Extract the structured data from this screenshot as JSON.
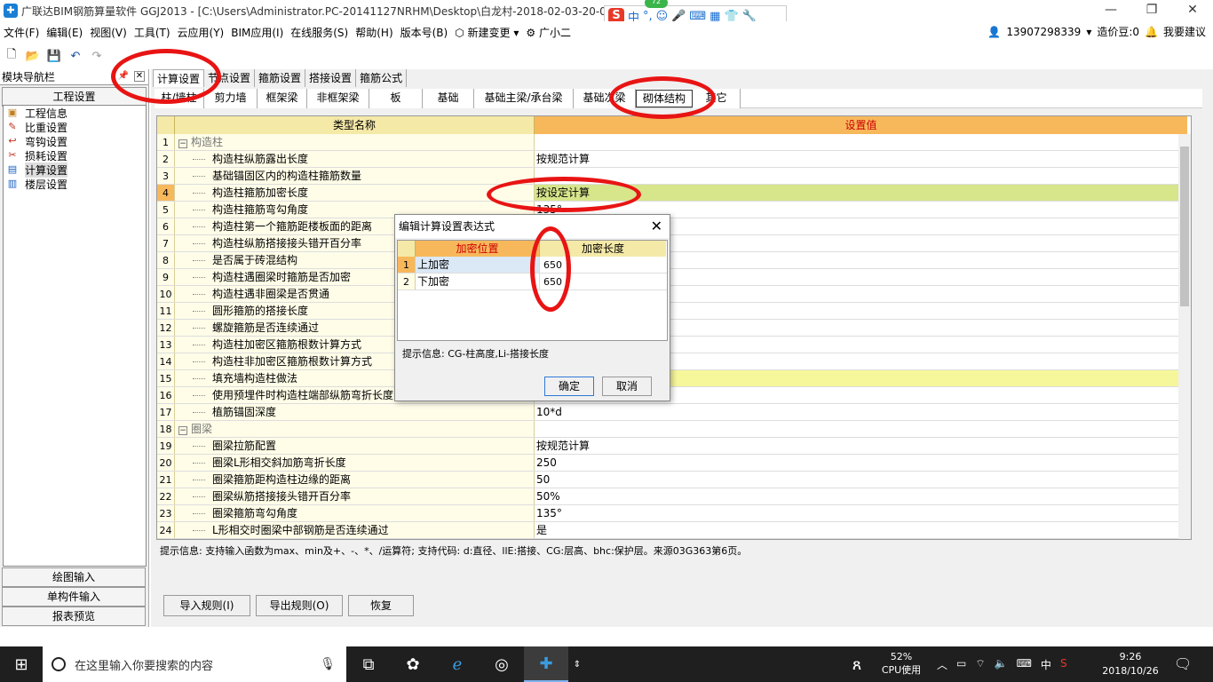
{
  "window": {
    "title": "广联达BIM钢筋算量软件 GGJ2013 - [C:\\Users\\Administrator.PC-20141127NRHM\\Desktop\\白龙村-2018-02-03-20-08",
    "min": "—",
    "max": "❐",
    "close": "✕"
  },
  "ime": {
    "logo": "S",
    "mode": "中",
    "badge": "72"
  },
  "menu": {
    "items": [
      "文件(F)",
      "编辑(E)",
      "视图(V)",
      "工具(T)",
      "云应用(Y)",
      "BIM应用(I)",
      "在线服务(S)",
      "帮助(H)",
      "版本号(B)",
      "新建变更",
      "广小二"
    ],
    "phone": "13907298339",
    "beans": "造价豆:0",
    "suggest": "我要建议"
  },
  "nav": {
    "header": "模块导航栏",
    "section": "工程设置",
    "items": [
      "工程信息",
      "比重设置",
      "弯钩设置",
      "损耗设置",
      "计算设置",
      "楼层设置"
    ],
    "bottom": [
      "绘图输入",
      "单构件输入",
      "报表预览"
    ]
  },
  "tabs1": [
    "计算设置",
    "节点设置",
    "箍筋设置",
    "搭接设置",
    "箍筋公式"
  ],
  "tabs2": [
    "柱/墙柱",
    "剪力墙",
    "框架梁",
    "非框架梁",
    "板",
    "基础",
    "基础主梁/承台梁",
    "基础次梁",
    "砌体结构",
    "其它"
  ],
  "grid": {
    "headers": [
      "类型名称",
      "设置值"
    ],
    "rows": [
      {
        "n": "1",
        "name": "构造柱",
        "value": "",
        "group": true
      },
      {
        "n": "2",
        "name": "构造柱纵筋露出长度",
        "value": "按规范计算"
      },
      {
        "n": "3",
        "name": "基础锚固区内的构造柱箍筋数量",
        "value": ""
      },
      {
        "n": "4",
        "name": "构造柱箍筋加密长度",
        "value": "按设定计算"
      },
      {
        "n": "5",
        "name": "构造柱箍筋弯勾角度",
        "value": "135°"
      },
      {
        "n": "6",
        "name": "构造柱第一个箍筋距楼板面的距离",
        "value": ""
      },
      {
        "n": "7",
        "name": "构造柱纵筋搭接接头错开百分率",
        "value": ""
      },
      {
        "n": "8",
        "name": "是否属于砖混结构",
        "value": ""
      },
      {
        "n": "9",
        "name": "构造柱遇圈梁时箍筋是否加密",
        "value": ""
      },
      {
        "n": "10",
        "name": "构造柱遇非圈梁是否贯通",
        "value": ""
      },
      {
        "n": "11",
        "name": "圆形箍筋的搭接长度",
        "value": ""
      },
      {
        "n": "12",
        "name": "螺旋箍筋是否连续通过",
        "value": ""
      },
      {
        "n": "13",
        "name": "构造柱加密区箍筋根数计算方式",
        "value": ""
      },
      {
        "n": "14",
        "name": "构造柱非加密区箍筋根数计算方式",
        "value": ""
      },
      {
        "n": "15",
        "name": "填充墙构造柱做法",
        "value": ""
      },
      {
        "n": "16",
        "name": "使用预埋件时构造柱端部纵筋弯折长度",
        "value": ""
      },
      {
        "n": "17",
        "name": "植筋锚固深度",
        "value": "10*d"
      },
      {
        "n": "18",
        "name": "圈梁",
        "value": "",
        "group": true
      },
      {
        "n": "19",
        "name": "圈梁拉筋配置",
        "value": "按规范计算"
      },
      {
        "n": "20",
        "name": "圈梁L形相交斜加筋弯折长度",
        "value": "250"
      },
      {
        "n": "21",
        "name": "圈梁箍筋距构造柱边缘的距离",
        "value": "50"
      },
      {
        "n": "22",
        "name": "圈梁纵筋搭接接头错开百分率",
        "value": "50%"
      },
      {
        "n": "23",
        "name": "圈梁箍筋弯勾角度",
        "value": "135°"
      },
      {
        "n": "24",
        "name": "L形相交时圈梁中部钢筋是否连续通过",
        "value": "是"
      }
    ]
  },
  "hint": "提示信息: 支持输入函数为max、min及+、-、*、/运算符; 支持代码: d:直径、llE:搭接、CG:层高、bhc:保护层。来源03G363第6页。",
  "buttons": {
    "import": "导入规则(I)",
    "export": "导出规则(O)",
    "restore": "恢复"
  },
  "dialog": {
    "title": "编辑计算设置表达式",
    "headers": [
      "加密位置",
      "加密长度"
    ],
    "rows": [
      {
        "n": "1",
        "pos": "上加密",
        "len": "650"
      },
      {
        "n": "2",
        "pos": "下加密",
        "len": "650"
      }
    ],
    "hint": "提示信息: CG-柱高度,Li-搭接长度",
    "ok": "确定",
    "cancel": "取消"
  },
  "taskbar": {
    "search": "在这里输入你要搜索的内容",
    "cpu_pct": "52%",
    "cpu_label": "CPU使用",
    "ime": "中",
    "time": "9:26",
    "date": "2018/10/26"
  }
}
